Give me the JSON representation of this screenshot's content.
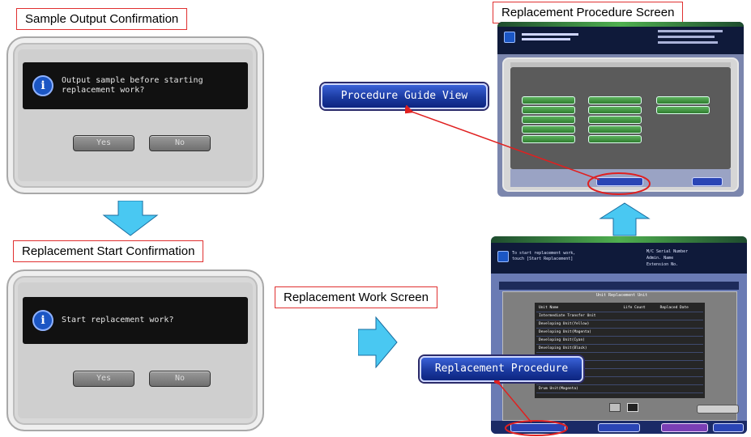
{
  "labels": {
    "sample_output": "Sample Output Confirmation",
    "replacement_start": "Replacement Start Confirmation",
    "replacement_procedure_screen": "Replacement Procedure Screen",
    "replacement_work_screen": "Replacement Work Screen"
  },
  "dialog_sample": {
    "message": "Output sample before starting\nreplacement work?",
    "yes": "Yes",
    "no": "No"
  },
  "dialog_start": {
    "message": "Start replacement work?",
    "yes": "Yes",
    "no": "No"
  },
  "callouts": {
    "procedure_guide_view": "Procedure Guide View",
    "replacement_procedure": "Replacement Procedure"
  },
  "work_screen": {
    "header_line1": "To start replacement work,",
    "header_line2": "touch [Start Replacement]",
    "serial_label": "M/C Serial Number",
    "admin_label": "Admin. Name",
    "extension_label": "Extension No.",
    "table_title": "Unit Replacement Unit",
    "col_unit_name": "Unit Name",
    "col_life": "Life Count",
    "col_replaced": "Replaced Date",
    "rows": [
      "Intermediate Transfer Unit",
      "Developing Unit(Yellow)",
      "Developing Unit(Magenta)",
      "Developing Unit(Cyan)",
      "Developing Unit(Black)",
      "Fusing Unit",
      "Drum Unit(Yellow)",
      "Drum Unit(Magenta)"
    ],
    "btn_replacement_procedure": "Replacement Procedure",
    "btn_start_replacement": "Start Replacement",
    "btn_close": "Close",
    "btn_print": "Print Mode",
    "btn_sample": "Sample Output Count"
  },
  "colors": {
    "callout_red": "#e02020",
    "arrow_blue": "#49c8f2",
    "button_blue": "#1b3aa0"
  }
}
